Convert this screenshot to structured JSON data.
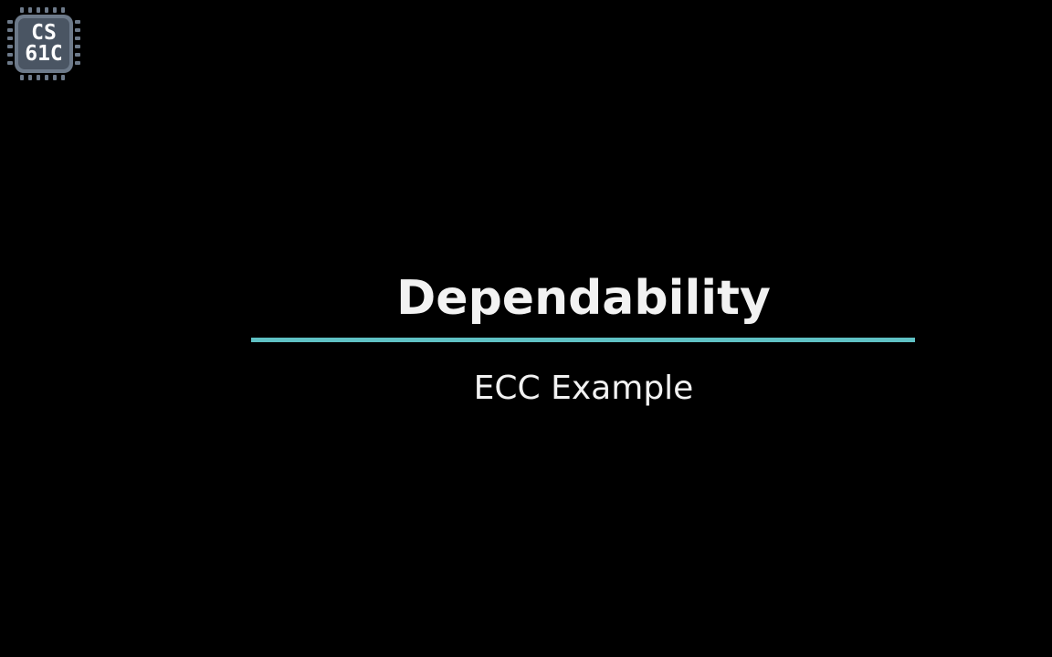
{
  "logo": {
    "line1": "CS",
    "line2": "61C",
    "icon": "chip-icon"
  },
  "slide": {
    "title": "Dependability",
    "subtitle": "ECC Example"
  },
  "colors": {
    "background": "#000000",
    "text": "#f2f2f2",
    "accent": "#5fc1c4",
    "chip": "#6d7a8a"
  }
}
